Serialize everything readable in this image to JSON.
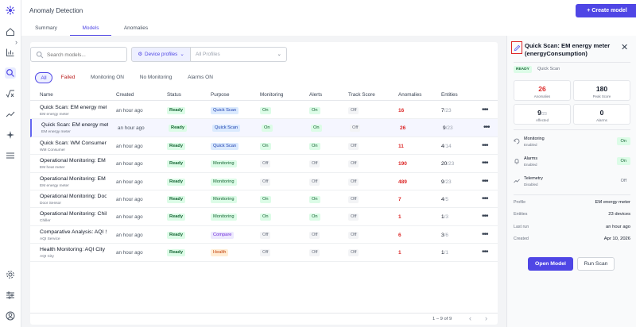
{
  "app": {
    "page_title": "Anomaly Detection",
    "create_button": "+ Create model"
  },
  "tabs": [
    {
      "label": "Summary"
    },
    {
      "label": "Models"
    },
    {
      "label": "Anomalies"
    }
  ],
  "toolbar": {
    "search_placeholder": "Search models...",
    "device_profiles_label": "Device profiles",
    "all_profiles_placeholder": "All Profiles"
  },
  "filters": [
    "All",
    "Failed",
    "Monitoring ON",
    "No Monitoring",
    "Alarms ON"
  ],
  "table": {
    "columns": [
      "Name",
      "Created",
      "Status",
      "Purpose",
      "Monitoring",
      "Alerts",
      "Track Score",
      "Anomalies",
      "Entities"
    ],
    "rows": [
      {
        "name": "Quick Scan: EM energy meter (energyConsumption)",
        "sub": "EM energy meter",
        "created": "an hour ago",
        "status": "Ready",
        "purpose": "Quick Scan",
        "monitoring": "On",
        "alerts": "On",
        "track": "Off",
        "anomalies": "16",
        "ent_num": "7",
        "ent_tot": "/23"
      },
      {
        "name": "Quick Scan: EM energy meter (energyConsumption)",
        "sub": "EM energy meter",
        "created": "an hour ago",
        "status": "Ready",
        "purpose": "Quick Scan",
        "monitoring": "On",
        "alerts": "On",
        "track": "Off",
        "anomalies": "26",
        "ent_num": "9",
        "ent_tot": "/23"
      },
      {
        "name": "Quick Scan: WM Consumer (consumption)",
        "sub": "WM Consumer",
        "created": "an hour ago",
        "status": "Ready",
        "purpose": "Quick Scan",
        "monitoring": "On",
        "alerts": "On",
        "track": "Off",
        "anomalies": "11",
        "ent_num": "4",
        "ent_tot": "/14"
      },
      {
        "name": "Operational Monitoring: EM heat meter",
        "sub": "EM heat meter",
        "created": "an hour ago",
        "status": "Ready",
        "purpose": "Monitoring",
        "monitoring": "Off",
        "alerts": "Off",
        "track": "Off",
        "anomalies": "190",
        "ent_num": "20",
        "ent_tot": "/23"
      },
      {
        "name": "Operational Monitoring: EM energy meter",
        "sub": "EM energy meter",
        "created": "an hour ago",
        "status": "Ready",
        "purpose": "Monitoring",
        "monitoring": "Off",
        "alerts": "Off",
        "track": "Off",
        "anomalies": "489",
        "ent_num": "9",
        "ent_tot": "/23"
      },
      {
        "name": "Operational Monitoring: Door Sensor",
        "sub": "Door Sensor",
        "created": "an hour ago",
        "status": "Ready",
        "purpose": "Monitoring",
        "monitoring": "On",
        "alerts": "On",
        "track": "Off",
        "anomalies": "7",
        "ent_num": "4",
        "ent_tot": "/5"
      },
      {
        "name": "Operational Monitoring: Chiller",
        "sub": "Chiller",
        "created": "an hour ago",
        "status": "Ready",
        "purpose": "Monitoring",
        "monitoring": "On",
        "alerts": "On",
        "track": "Off",
        "anomalies": "1",
        "ent_num": "1",
        "ent_tot": "/3"
      },
      {
        "name": "Comparative Analysis: AQI Service",
        "sub": "AQI Service",
        "created": "an hour ago",
        "status": "Ready",
        "purpose": "Compare",
        "monitoring": "Off",
        "alerts": "Off",
        "track": "Off",
        "anomalies": "6",
        "ent_num": "3",
        "ent_tot": "/6"
      },
      {
        "name": "Health Monitoring: AQI City (aqi)",
        "sub": "AQI City",
        "created": "an hour ago",
        "status": "Ready",
        "purpose": "Health",
        "monitoring": "Off",
        "alerts": "Off",
        "track": "Off",
        "anomalies": "1",
        "ent_num": "1",
        "ent_tot": "/1"
      }
    ]
  },
  "pagination": {
    "text": "1 – 9 of 9"
  },
  "panel": {
    "title": "Quick Scan: EM energy meter (energyConsumption)",
    "status": "READY",
    "type": "Quick Scan",
    "stats": {
      "anomalies": {
        "value": "26",
        "label": "Anomalies"
      },
      "peak": {
        "value": "180",
        "label": "Peak Score"
      },
      "affected": {
        "value": "9",
        "total": "/23",
        "label": "Affected"
      },
      "alarms": {
        "value": "0",
        "label": "Alarms"
      }
    },
    "toggles": [
      {
        "label": "Monitoring",
        "sub": "Enabled",
        "value": "On"
      },
      {
        "label": "Alarms",
        "sub": "Enabled",
        "value": "On"
      },
      {
        "label": "Telemetry",
        "sub": "Disabled",
        "value": "Off"
      }
    ],
    "meta": [
      {
        "key": "Profile",
        "value": "EM energy meter"
      },
      {
        "key": "Entities",
        "value": "23 devices"
      },
      {
        "key": "Last run",
        "value": "an hour ago"
      },
      {
        "key": "Created",
        "value": "Apr 10, 2026"
      }
    ],
    "open_button": "Open Model",
    "scan_button": "Run Scan"
  }
}
